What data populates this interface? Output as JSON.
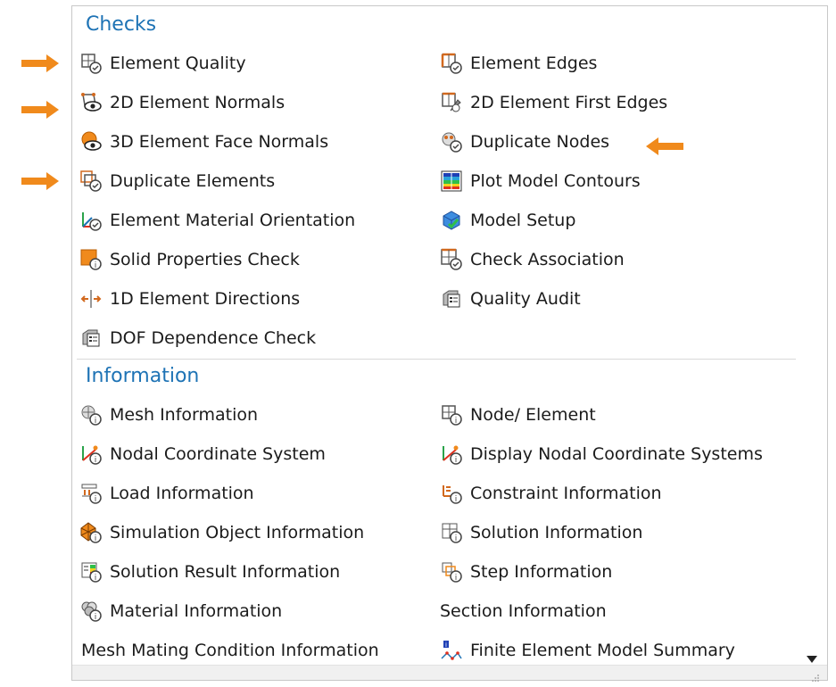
{
  "sections": {
    "checks": {
      "title": "Checks",
      "items": [
        {
          "label": "Element Quality",
          "icon": "element-quality-icon"
        },
        {
          "label": "Element Edges",
          "icon": "element-edges-icon"
        },
        {
          "label": "2D Element Normals",
          "icon": "2d-element-normals-icon"
        },
        {
          "label": "2D Element First Edges",
          "icon": "2d-element-first-edges-icon"
        },
        {
          "label": "3D Element Face Normals",
          "icon": "3d-element-face-normals-icon"
        },
        {
          "label": "Duplicate Nodes",
          "icon": "duplicate-nodes-icon"
        },
        {
          "label": "Duplicate Elements",
          "icon": "duplicate-elements-icon"
        },
        {
          "label": "Plot Model Contours",
          "icon": "plot-model-contours-icon"
        },
        {
          "label": "Element Material Orientation",
          "icon": "element-material-orientation-icon"
        },
        {
          "label": "Model Setup",
          "icon": "model-setup-icon"
        },
        {
          "label": "Solid Properties Check",
          "icon": "solid-properties-check-icon"
        },
        {
          "label": "Check Association",
          "icon": "check-association-icon"
        },
        {
          "label": "1D Element Directions",
          "icon": "1d-element-directions-icon"
        },
        {
          "label": "Quality Audit",
          "icon": "quality-audit-icon"
        },
        {
          "label": "DOF Dependence Check",
          "icon": "dof-dependence-check-icon"
        }
      ]
    },
    "information": {
      "title": "Information",
      "items": [
        {
          "label": "Mesh Information",
          "icon": "mesh-information-icon"
        },
        {
          "label": "Node/ Element",
          "icon": "node-element-icon"
        },
        {
          "label": "Nodal Coordinate System",
          "icon": "nodal-coordinate-system-icon"
        },
        {
          "label": "Display Nodal Coordinate Systems",
          "icon": "display-nodal-coordinate-systems-icon"
        },
        {
          "label": "Load Information",
          "icon": "load-information-icon"
        },
        {
          "label": "Constraint Information",
          "icon": "constraint-information-icon"
        },
        {
          "label": "Simulation Object Information",
          "icon": "simulation-object-information-icon"
        },
        {
          "label": "Solution Information",
          "icon": "solution-information-icon"
        },
        {
          "label": "Solution Result Information",
          "icon": "solution-result-information-icon"
        },
        {
          "label": "Step Information",
          "icon": "step-information-icon"
        },
        {
          "label": "Material Information",
          "icon": "material-information-icon"
        },
        {
          "label": "Section Information",
          "icon": ""
        },
        {
          "label": "Mesh Mating Condition Information",
          "icon": ""
        },
        {
          "label": "Finite Element Model Summary",
          "icon": "finite-element-model-summary-icon"
        }
      ]
    }
  },
  "colors": {
    "section_title": "#1e73b5",
    "annotation_arrow": "#f08a1c"
  }
}
